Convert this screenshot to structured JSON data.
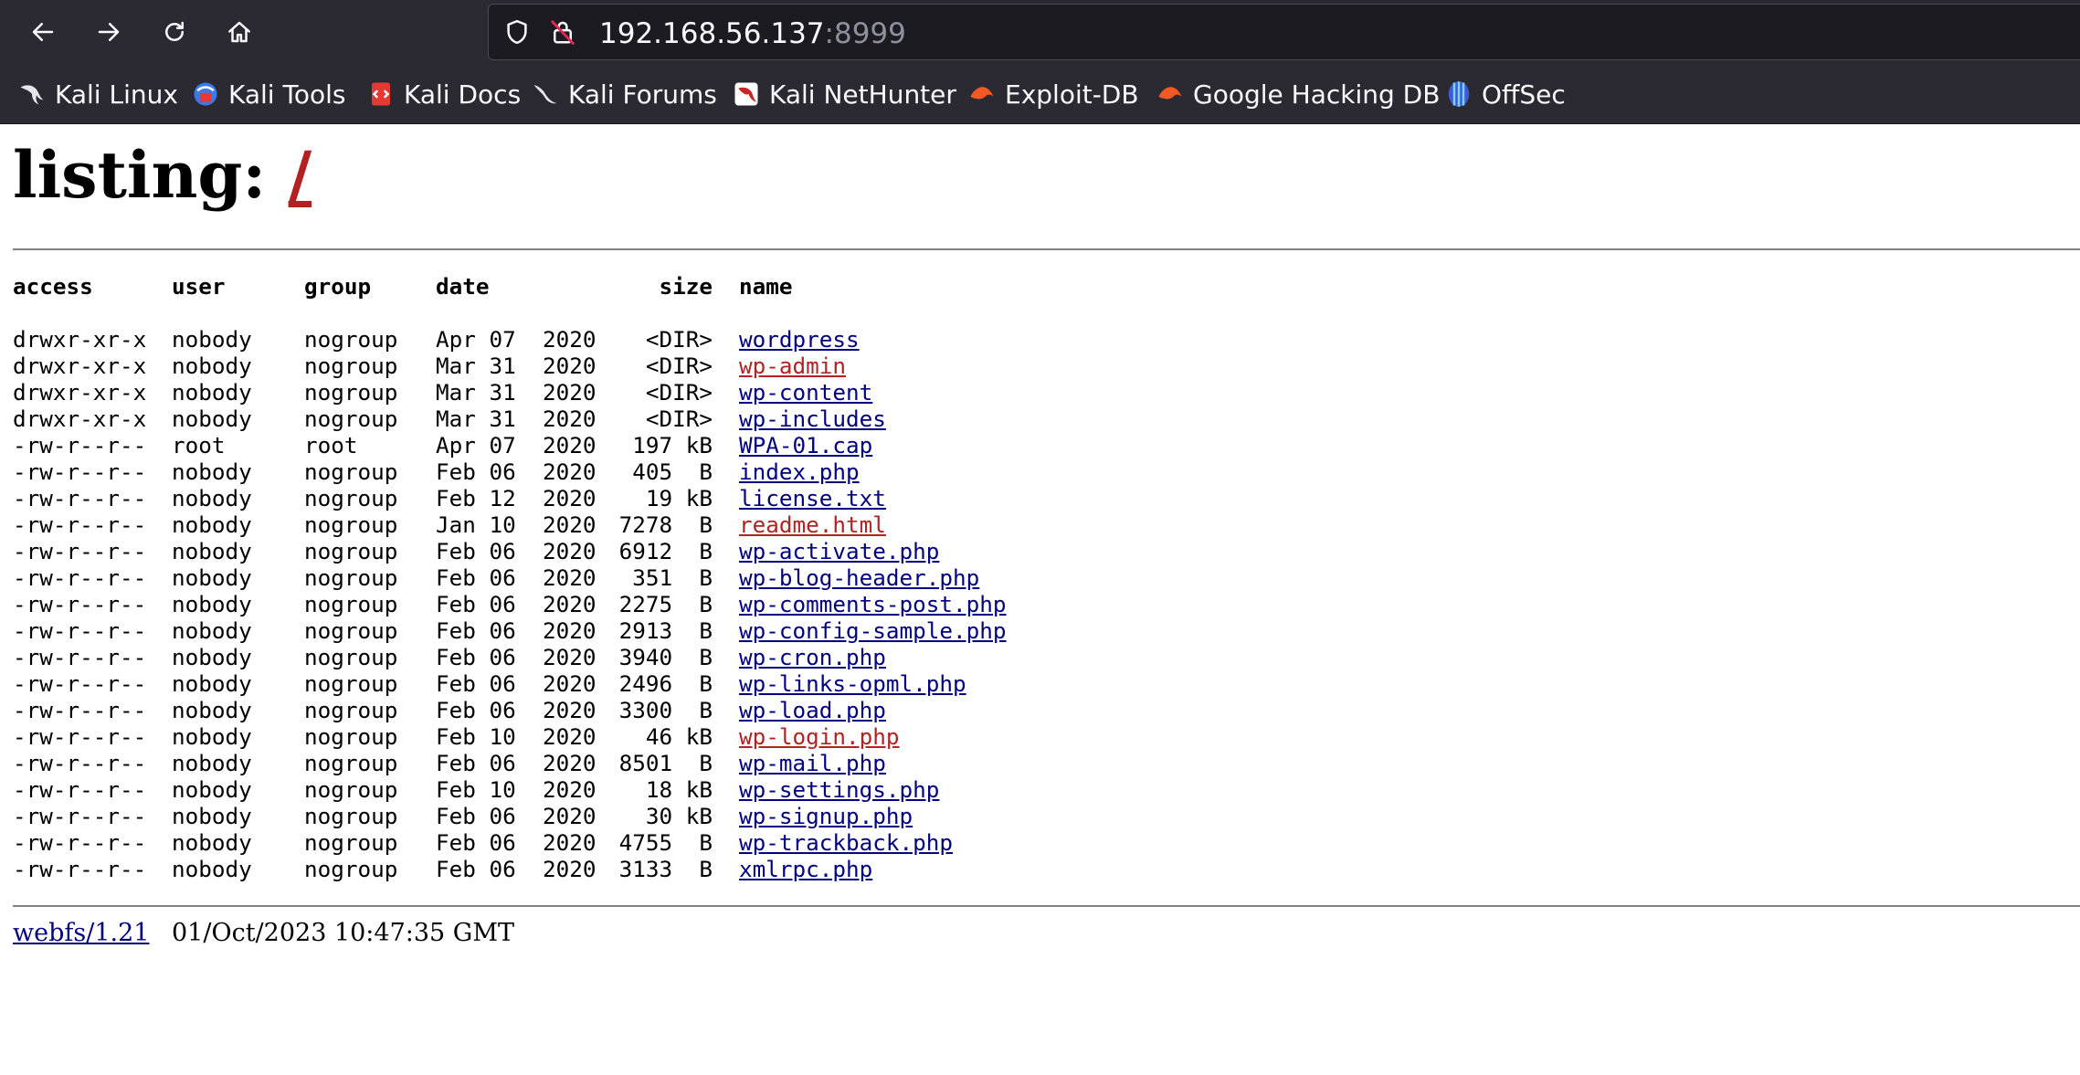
{
  "browser": {
    "url_host": "192.168.56.137",
    "url_port": ":8999",
    "bookmarks": [
      {
        "label": "Kali Linux",
        "icon": "kali-dragon-icon"
      },
      {
        "label": "Kali Tools",
        "icon": "kali-tools-icon"
      },
      {
        "label": "Kali Docs",
        "icon": "kali-docs-icon"
      },
      {
        "label": "Kali Forums",
        "icon": "kali-forums-icon"
      },
      {
        "label": "Kali NetHunter",
        "icon": "kali-nethunter-icon"
      },
      {
        "label": "Exploit-DB",
        "icon": "exploit-db-icon"
      },
      {
        "label": "Google Hacking DB",
        "icon": "ghdb-icon"
      },
      {
        "label": "OffSec",
        "icon": "offsec-icon"
      }
    ]
  },
  "page": {
    "heading_prefix": "listing: ",
    "heading_path": "/",
    "columns": {
      "access": "access",
      "user": "user",
      "group": "group",
      "date": "date",
      "size": "size",
      "name": "name"
    },
    "rows": [
      {
        "access": "drwxr-xr-x",
        "user": "nobody",
        "group": "nogroup",
        "date": "Apr 07  2020",
        "size": "<DIR>",
        "name": "wordpress",
        "visited": false
      },
      {
        "access": "drwxr-xr-x",
        "user": "nobody",
        "group": "nogroup",
        "date": "Mar 31  2020",
        "size": "<DIR>",
        "name": "wp-admin",
        "visited": true
      },
      {
        "access": "drwxr-xr-x",
        "user": "nobody",
        "group": "nogroup",
        "date": "Mar 31  2020",
        "size": "<DIR>",
        "name": "wp-content",
        "visited": false
      },
      {
        "access": "drwxr-xr-x",
        "user": "nobody",
        "group": "nogroup",
        "date": "Mar 31  2020",
        "size": "<DIR>",
        "name": "wp-includes",
        "visited": false
      },
      {
        "access": "-rw-r--r--",
        "user": "root",
        "group": "root",
        "date": "Apr 07  2020",
        "size": "197 kB",
        "name": "WPA-01.cap",
        "visited": false
      },
      {
        "access": "-rw-r--r--",
        "user": "nobody",
        "group": "nogroup",
        "date": "Feb 06  2020",
        "size": "405  B",
        "name": "index.php",
        "visited": false
      },
      {
        "access": "-rw-r--r--",
        "user": "nobody",
        "group": "nogroup",
        "date": "Feb 12  2020",
        "size": "19 kB",
        "name": "license.txt",
        "visited": false
      },
      {
        "access": "-rw-r--r--",
        "user": "nobody",
        "group": "nogroup",
        "date": "Jan 10  2020",
        "size": "7278  B",
        "name": "readme.html",
        "visited": true
      },
      {
        "access": "-rw-r--r--",
        "user": "nobody",
        "group": "nogroup",
        "date": "Feb 06  2020",
        "size": "6912  B",
        "name": "wp-activate.php",
        "visited": false
      },
      {
        "access": "-rw-r--r--",
        "user": "nobody",
        "group": "nogroup",
        "date": "Feb 06  2020",
        "size": "351  B",
        "name": "wp-blog-header.php",
        "visited": false
      },
      {
        "access": "-rw-r--r--",
        "user": "nobody",
        "group": "nogroup",
        "date": "Feb 06  2020",
        "size": "2275  B",
        "name": "wp-comments-post.php",
        "visited": false
      },
      {
        "access": "-rw-r--r--",
        "user": "nobody",
        "group": "nogroup",
        "date": "Feb 06  2020",
        "size": "2913  B",
        "name": "wp-config-sample.php",
        "visited": false
      },
      {
        "access": "-rw-r--r--",
        "user": "nobody",
        "group": "nogroup",
        "date": "Feb 06  2020",
        "size": "3940  B",
        "name": "wp-cron.php",
        "visited": false
      },
      {
        "access": "-rw-r--r--",
        "user": "nobody",
        "group": "nogroup",
        "date": "Feb 06  2020",
        "size": "2496  B",
        "name": "wp-links-opml.php",
        "visited": false
      },
      {
        "access": "-rw-r--r--",
        "user": "nobody",
        "group": "nogroup",
        "date": "Feb 06  2020",
        "size": "3300  B",
        "name": "wp-load.php",
        "visited": false
      },
      {
        "access": "-rw-r--r--",
        "user": "nobody",
        "group": "nogroup",
        "date": "Feb 10  2020",
        "size": "46 kB",
        "name": "wp-login.php",
        "visited": true
      },
      {
        "access": "-rw-r--r--",
        "user": "nobody",
        "group": "nogroup",
        "date": "Feb 06  2020",
        "size": "8501  B",
        "name": "wp-mail.php",
        "visited": false
      },
      {
        "access": "-rw-r--r--",
        "user": "nobody",
        "group": "nogroup",
        "date": "Feb 10  2020",
        "size": "18 kB",
        "name": "wp-settings.php",
        "visited": false
      },
      {
        "access": "-rw-r--r--",
        "user": "nobody",
        "group": "nogroup",
        "date": "Feb 06  2020",
        "size": "30 kB",
        "name": "wp-signup.php",
        "visited": false
      },
      {
        "access": "-rw-r--r--",
        "user": "nobody",
        "group": "nogroup",
        "date": "Feb 06  2020",
        "size": "4755  B",
        "name": "wp-trackback.php",
        "visited": false
      },
      {
        "access": "-rw-r--r--",
        "user": "nobody",
        "group": "nogroup",
        "date": "Feb 06  2020",
        "size": "3133  B",
        "name": "xmlrpc.php",
        "visited": false
      }
    ],
    "footer": {
      "server_link": "webfs/1.21",
      "timestamp": "01/Oct/2023 10:47:35 GMT"
    }
  },
  "colors": {
    "toolbar_bg": "#2b2a33",
    "urlbar_bg": "#1c1b22",
    "link": "#000080",
    "visited_link": "#b22222"
  }
}
